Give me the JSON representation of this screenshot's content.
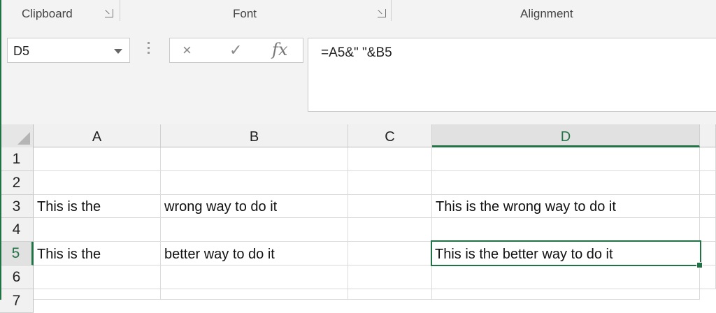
{
  "ribbon": {
    "groups": [
      {
        "label": "Clipboard"
      },
      {
        "label": "Font"
      },
      {
        "label": "Alignment"
      }
    ]
  },
  "formula_bar": {
    "name_box": "D5",
    "formula": "=A5&\" \"&B5",
    "cancel_icon": "×",
    "enter_icon": "✓",
    "fx_icon": "fx"
  },
  "sheet": {
    "columns": [
      "A",
      "B",
      "C",
      "D"
    ],
    "active_column": "D",
    "rows": [
      "1",
      "2",
      "3",
      "4",
      "5",
      "6",
      "7"
    ],
    "active_row": "5",
    "cells": {
      "A3": "This is the",
      "B3": "wrong way to do it",
      "D3": "This is the wrong way to do it",
      "A5": "This is the",
      "B5": "better way to do it",
      "D5": "This is the better way to do it"
    }
  },
  "colors": {
    "accent": "#217346"
  }
}
